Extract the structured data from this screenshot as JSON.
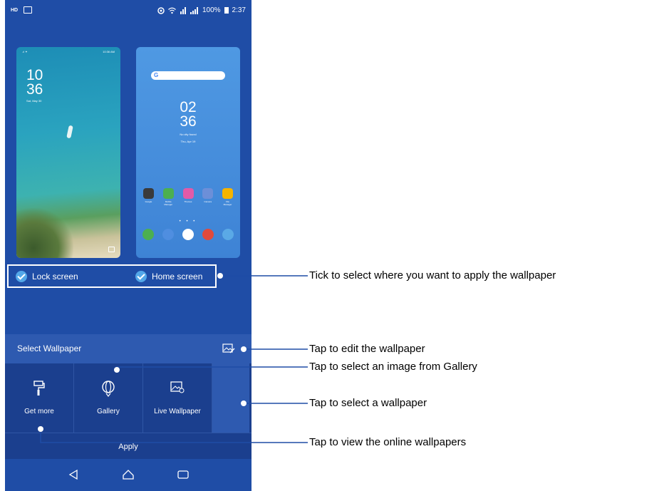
{
  "status_bar": {
    "hd_badge": "HD",
    "battery": "100%",
    "time": "2:37"
  },
  "lock_preview": {
    "status_time": "10:36 AM",
    "clock_hour": "10",
    "clock_min": "36",
    "date": "Sat, May 30"
  },
  "home_preview": {
    "search_logo": "G",
    "clock_hour": "02",
    "clock_min": "36",
    "weather": "No city found",
    "date": "Thu, Apr 19",
    "apps": [
      {
        "label": "Google",
        "color": "#3a3a3a"
      },
      {
        "label": "Mobile Manager",
        "color": "#4caf50"
      },
      {
        "label": "Themes",
        "color": "#e25aa8"
      },
      {
        "label": "Camera",
        "color": "#6c8fd8"
      },
      {
        "label": "File Manager",
        "color": "#f5b400"
      }
    ],
    "page_dots": "• • •",
    "dock_colors": [
      "#4caf50",
      "#4f8ee0",
      "#ffffff",
      "#e04a3c",
      "#5aa9e6"
    ]
  },
  "targets": {
    "lock_label": "Lock screen",
    "home_label": "Home screen"
  },
  "select_wallpaper": {
    "title": "Select Wallpaper"
  },
  "tiles": {
    "get_more": "Get more",
    "gallery": "Gallery",
    "live": "Live Wallpaper"
  },
  "apply_label": "Apply",
  "annotations": {
    "tick": "Tick to select where you want to apply the wallpaper",
    "edit": "Tap to edit the wallpaper",
    "gallery": "Tap to select an image from Gallery",
    "select": "Tap to select a wallpaper",
    "online": "Tap to view the online wallpapers"
  },
  "colors": {
    "phone_bg": "#1f4da6",
    "tile_bg": "#1b3f8e",
    "accent_check": "#53a7e8"
  }
}
